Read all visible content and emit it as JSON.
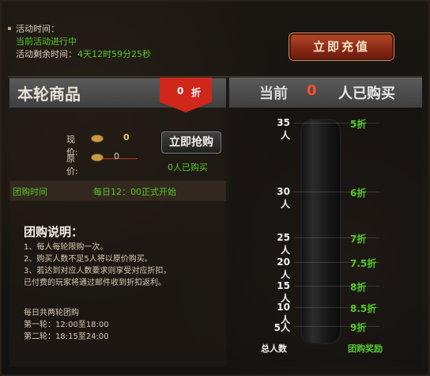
{
  "header": {
    "activity_time_label": "活动时间：",
    "ongoing_text": "当前活动进行中",
    "remaining_label": "活动剩余时间：",
    "remaining_value": "4天12时59分25秒"
  },
  "recharge_button_label": "立即充值",
  "left": {
    "title": "本轮商品",
    "discount_value": "0",
    "discount_unit": "折",
    "current_price_label": "现价:",
    "current_price_value": "0",
    "original_price_label": "原价:",
    "original_price_value": "0",
    "buy_button_label": "立即抢购",
    "bought_count_text": "0人已购买",
    "group_time_label": "团购时间",
    "group_time_value": "每日12：00正式开始",
    "explanation_title": "团购说明：",
    "explanation_lines": [
      "1、每人每轮限购一次。",
      "2、购买人数不足5人将以原价购买。",
      "3、若达到对应人数要求则享受对应折扣，",
      "已付费的玩家将通过邮件收到折扣返利。"
    ],
    "schedule_lines": [
      "每日共两轮团购",
      "第一轮：12:00至18:00",
      "第二轮：18:15至24:00"
    ]
  },
  "right": {
    "title_prefix": "当前",
    "current_count": "0",
    "title_suffix": "人已购买",
    "tiers": [
      {
        "people": "35人",
        "discount": "5折"
      },
      {
        "people": "30人",
        "discount": "6折"
      },
      {
        "people": "25人",
        "discount": "7折"
      },
      {
        "people": "20人",
        "discount": "7.5折"
      },
      {
        "people": "15人",
        "discount": "8折"
      },
      {
        "people": "10人",
        "discount": "8.5折"
      },
      {
        "people": "5人",
        "discount": "9折"
      }
    ],
    "footer_left": "总人数",
    "footer_right": "团购奖励"
  },
  "colors": {
    "green_text": "#57c72d",
    "discount_badge": "#d1261a",
    "recharge_button": "#8b2b16",
    "count_red": "#ff4e2e"
  }
}
